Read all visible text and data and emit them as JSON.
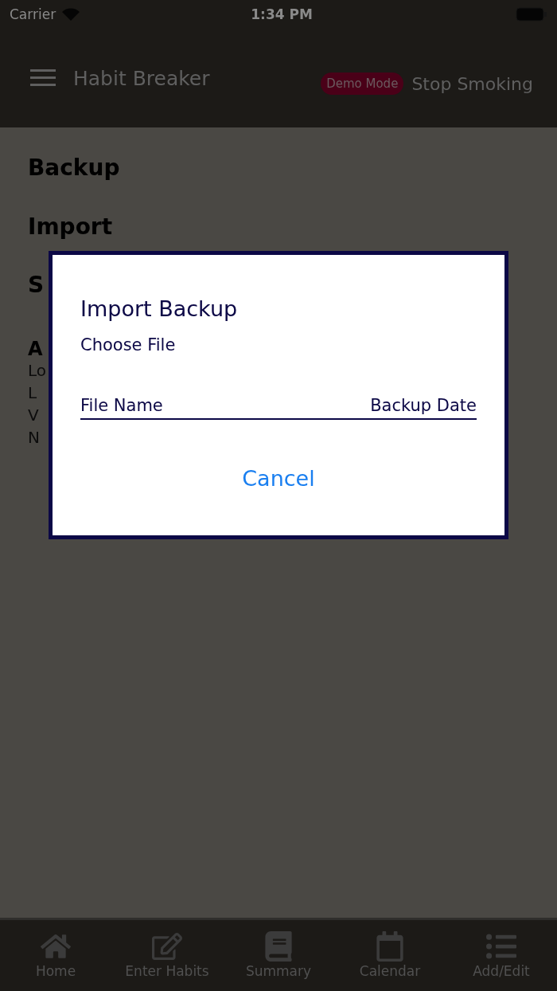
{
  "status_bar": {
    "carrier": "Carrier",
    "time": "1:34 PM"
  },
  "header": {
    "title": "Habit Breaker",
    "badge": "Demo Mode",
    "habit": "Stop Smoking"
  },
  "sections": [
    {
      "kind": "heading",
      "text": "Backup"
    },
    {
      "kind": "heading",
      "text": "Import"
    },
    {
      "kind": "heading",
      "text": "S"
    }
  ],
  "about": {
    "heading": "A",
    "lines": [
      "Lo",
      "L",
      "V",
      "N"
    ]
  },
  "dialog": {
    "title": "Import Backup",
    "choose_file": "Choose File",
    "columns": [
      "File Name",
      "Backup Date"
    ],
    "cancel": "Cancel"
  },
  "tabs": [
    {
      "label": "Home"
    },
    {
      "label": "Enter Habits"
    },
    {
      "label": "Summary"
    },
    {
      "label": "Calendar"
    },
    {
      "label": "Add/Edit"
    }
  ]
}
